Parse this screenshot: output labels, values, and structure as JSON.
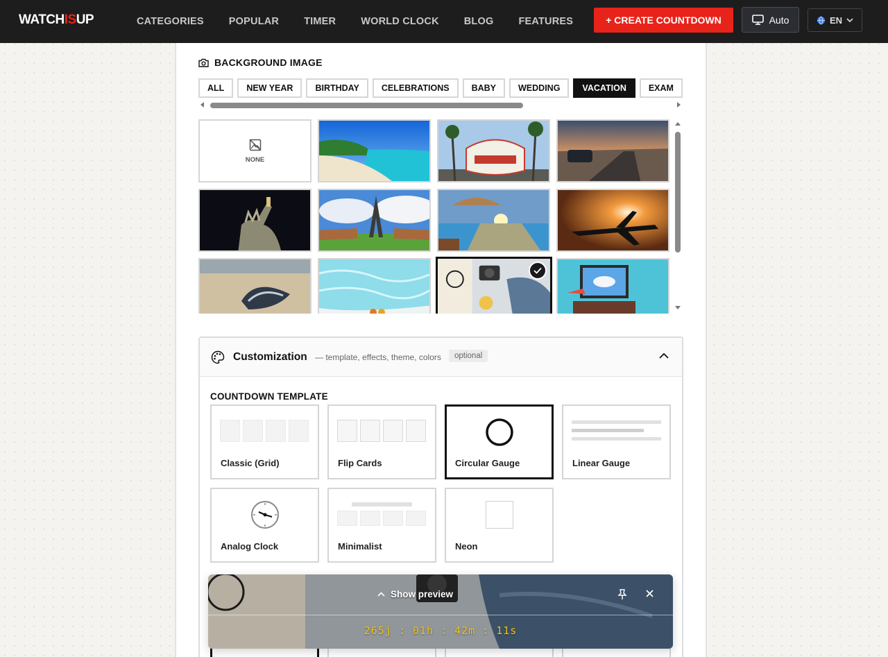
{
  "nav": {
    "logo_a": "WATCH",
    "logo_b": "IS",
    "logo_c": "UP",
    "menu": [
      "CATEGORIES",
      "POPULAR",
      "TIMER",
      "WORLD CLOCK",
      "BLOG",
      "FEATURES"
    ],
    "create_label": "+ CREATE COUNTDOWN",
    "theme_label": "Auto",
    "lang_label": "EN"
  },
  "background": {
    "title": "BACKGROUND IMAGE",
    "categories": [
      "ALL",
      "NEW YEAR",
      "BIRTHDAY",
      "CELEBRATIONS",
      "BABY",
      "WEDDING",
      "VACATION",
      "EXAM"
    ],
    "active_category": "VACATION",
    "none_label": "NONE",
    "tiles": [
      "none",
      "tropical-beach",
      "las-vegas-sign",
      "desert-road-car",
      "statue-of-liberty",
      "eiffel-tower",
      "pool-sunset",
      "airplane-sunset",
      "seashell-sand",
      "pool-water",
      "travel-flatlay",
      "laptop-beach"
    ],
    "selected_tile": "travel-flatlay"
  },
  "customization": {
    "title": "Customization",
    "subtitle": "— template, effects, theme, colors",
    "badge": "optional",
    "template_title": "COUNTDOWN TEMPLATE",
    "templates": [
      "Classic (Grid)",
      "Flip Cards",
      "Circular Gauge",
      "Linear Gauge",
      "Analog Clock",
      "Minimalist",
      "Neon"
    ],
    "selected_template": "Circular Gauge"
  },
  "preview": {
    "label": "Show preview",
    "days": "265j",
    "hours": "01h",
    "minutes": "42m",
    "seconds": "11s",
    "sep": ":"
  },
  "colors": {
    "accent": "#e8231a",
    "nav_bg": "#1d1d1d",
    "timer": "#f2c30f"
  }
}
